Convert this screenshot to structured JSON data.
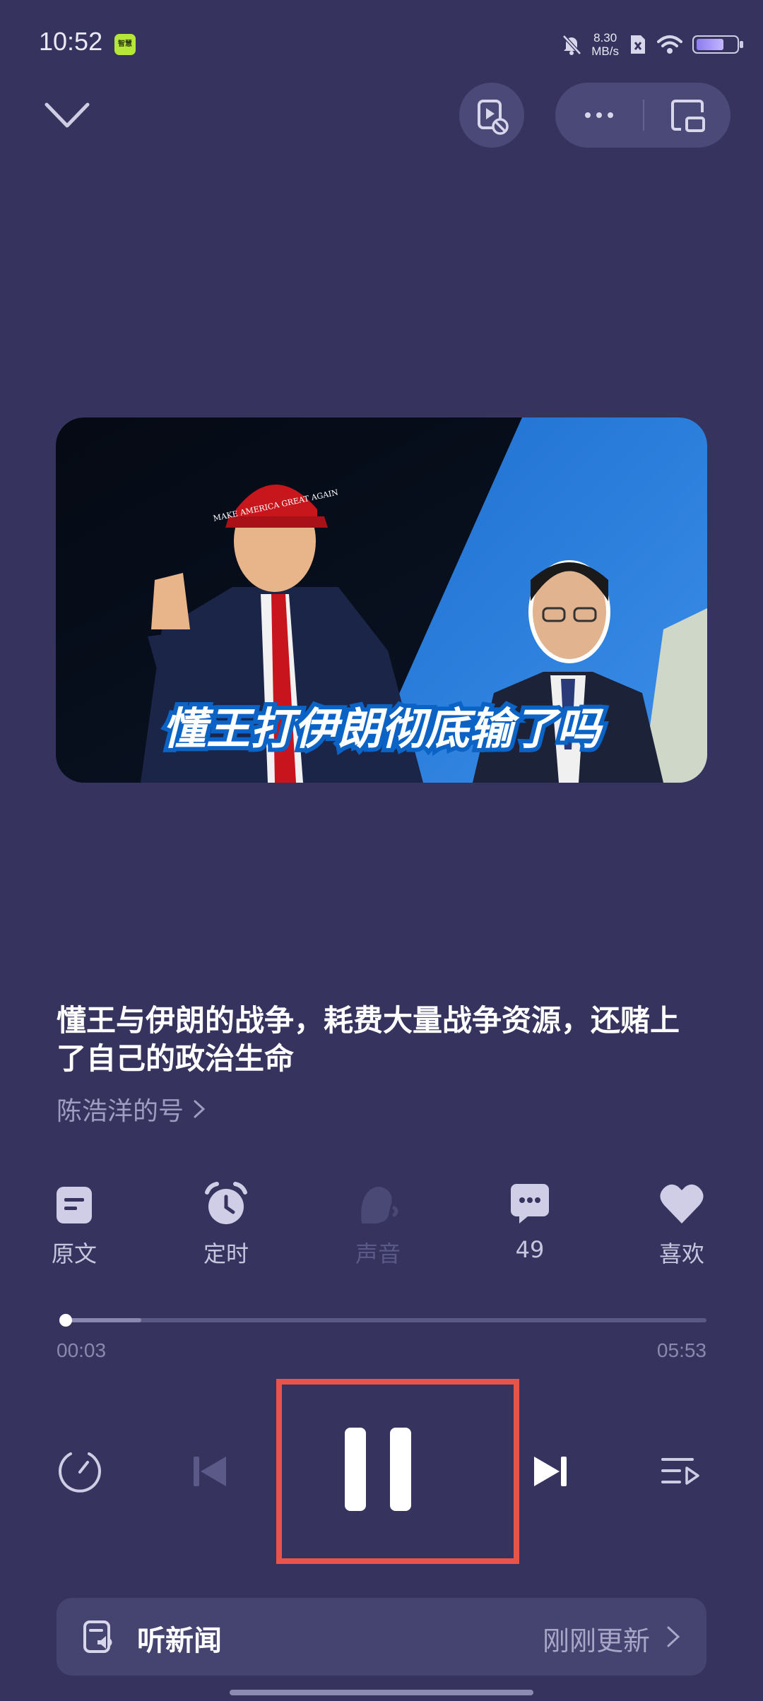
{
  "status_bar": {
    "time": "10:52",
    "app_badge": "智慧",
    "net_speed_value": "8.30",
    "net_speed_unit": "MB/s",
    "battery_level": 0.7
  },
  "player": {
    "cover_caption": "懂王打伊朗彻底输了吗",
    "cover_hat_text": "MAKE AMERICA GREAT AGAIN",
    "title": "懂王与伊朗的战争，耗费大量战争资源，还赌上了自己的政治生命",
    "channel": "陈浩洋的号",
    "actions": [
      {
        "label": "原文",
        "icon": "document-icon",
        "enabled": true
      },
      {
        "label": "定时",
        "icon": "alarm-clock-icon",
        "enabled": true
      },
      {
        "label": "声音",
        "icon": "voice-icon",
        "enabled": false
      },
      {
        "label": "49",
        "icon": "comment-icon",
        "enabled": true
      },
      {
        "label": "喜欢",
        "icon": "heart-icon",
        "enabled": true
      }
    ],
    "progress": {
      "current": "00:03",
      "total": "05:53",
      "played_fraction": 0.008,
      "buffered_fraction": 0.125
    },
    "controls": [
      "speed-icon",
      "previous-icon",
      "pause-icon",
      "next-icon",
      "playlist-icon"
    ]
  },
  "news_bar": {
    "title": "听新闻",
    "status": "刚刚更新"
  },
  "colors": {
    "background": "#36345e",
    "surface": "#4b4977",
    "highlight_box": "#e8534a"
  }
}
